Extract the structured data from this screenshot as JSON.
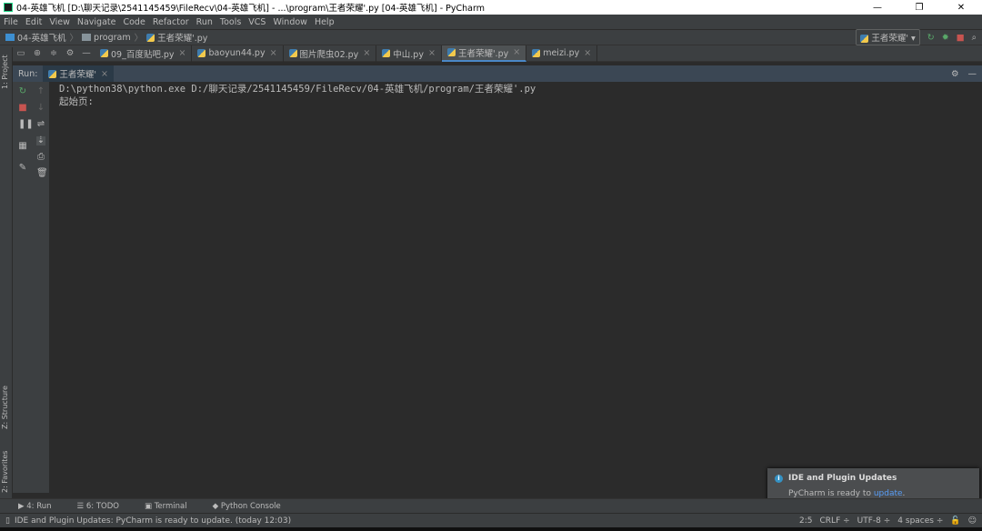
{
  "window": {
    "title": "04-英雄飞机 [D:\\聊天记录\\2541145459\\FileRecv\\04-英雄飞机] - ...\\program\\王者荣耀'.py [04-英雄飞机] - PyCharm"
  },
  "menu": [
    "File",
    "Edit",
    "View",
    "Navigate",
    "Code",
    "Refactor",
    "Run",
    "Tools",
    "VCS",
    "Window",
    "Help"
  ],
  "breadcrumb": [
    "04-英雄飞机",
    "program",
    "王者荣耀'.py"
  ],
  "run_config": "王者荣耀'",
  "tabs": [
    {
      "label": "09_百度贴吧.py"
    },
    {
      "label": "baoyun44.py"
    },
    {
      "label": "图片爬虫02.py"
    },
    {
      "label": "中山.py"
    },
    {
      "label": "王者荣耀'.py"
    },
    {
      "label": "meizi.py"
    }
  ],
  "side": {
    "project": "1: Project",
    "structure": "Z: Structure",
    "favorites": "2: Favorites"
  },
  "run": {
    "label": "Run:",
    "tab": "王者荣耀'",
    "lines": [
      "D:\\python38\\python.exe D:/聊天记录/2541145459/FileRecv/04-英雄飞机/program/王者荣耀'.py",
      "起始页:"
    ]
  },
  "bottom_tabs": [
    "4: Run",
    "6: TODO",
    "Terminal",
    "Python Console"
  ],
  "notification": {
    "title": "IDE and Plugin Updates",
    "body": "PyCharm is ready to ",
    "link": "update",
    "end": "."
  },
  "status": {
    "message": "IDE and Plugin Updates: PyCharm is ready to update. (today 12:03)",
    "position": "2:5",
    "line_sep": "CRLF ÷",
    "encoding": "UTF-8 ÷",
    "indent": "4 spaces ÷"
  }
}
